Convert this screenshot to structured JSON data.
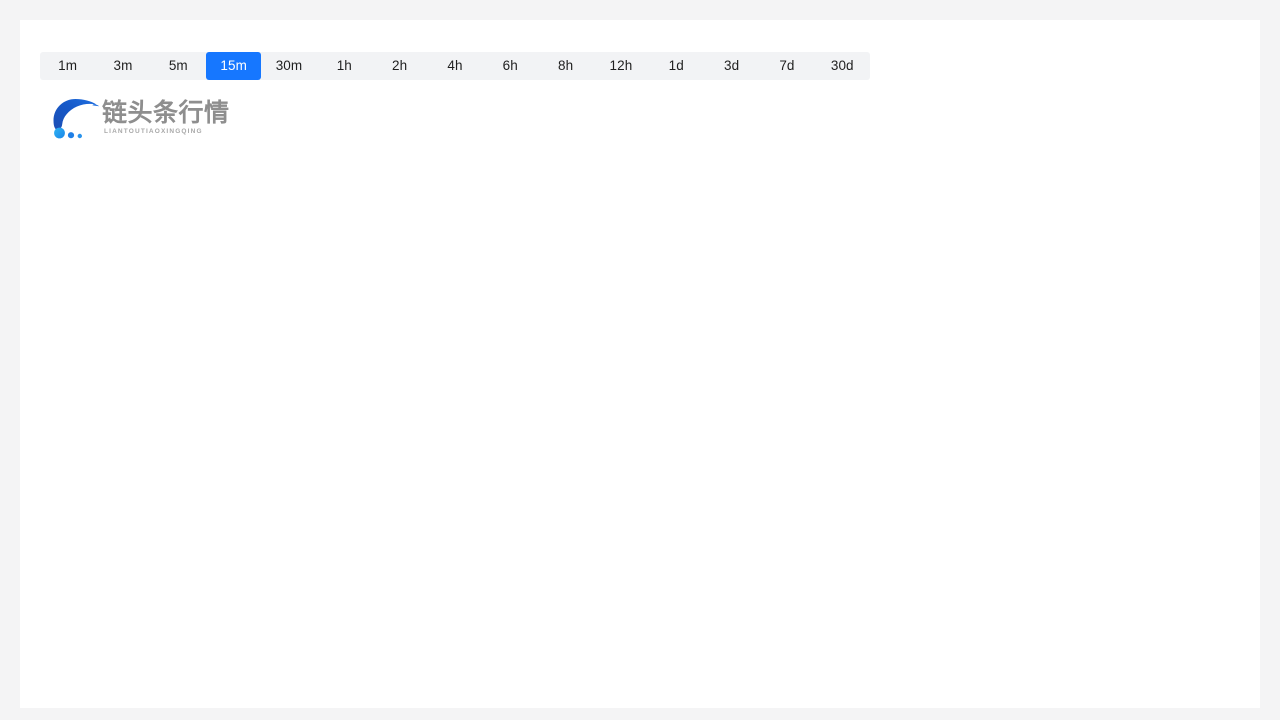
{
  "theme": {
    "page_background": "#f4f4f5",
    "card_background": "#ffffff",
    "tabbar_background": "#f2f3f5",
    "accent_blue": "#1677ff",
    "tab_text": "#1f1f1f",
    "tab_active_text": "#ffffff",
    "logo_text_gray": "#8e8e8e",
    "logo_pinyin_gray": "#a8a8a8",
    "logo_mark_blue_dark": "#1555c0",
    "logo_mark_blue": "#1677e8",
    "logo_mark_cyan": "#29a8ef"
  },
  "interval_selector": {
    "name": "timeframe-selector",
    "selected": "15m",
    "tabs": [
      {
        "label": "1m",
        "active": false
      },
      {
        "label": "3m",
        "active": false
      },
      {
        "label": "5m",
        "active": false
      },
      {
        "label": "15m",
        "active": true
      },
      {
        "label": "30m",
        "active": false
      },
      {
        "label": "1h",
        "active": false
      },
      {
        "label": "2h",
        "active": false
      },
      {
        "label": "4h",
        "active": false
      },
      {
        "label": "6h",
        "active": false
      },
      {
        "label": "8h",
        "active": false
      },
      {
        "label": "12h",
        "active": false
      },
      {
        "label": "1d",
        "active": false
      },
      {
        "label": "3d",
        "active": false
      },
      {
        "label": "7d",
        "active": false
      },
      {
        "label": "30d",
        "active": false
      }
    ]
  },
  "brand": {
    "icon_name": "liantoutiao-swoosh-logo-icon",
    "name_cn": "链头条行情",
    "name_pinyin": "LIANTOUTIAOXINGQING"
  },
  "chart": {
    "name": "price-chart",
    "state": "empty",
    "content": ""
  }
}
